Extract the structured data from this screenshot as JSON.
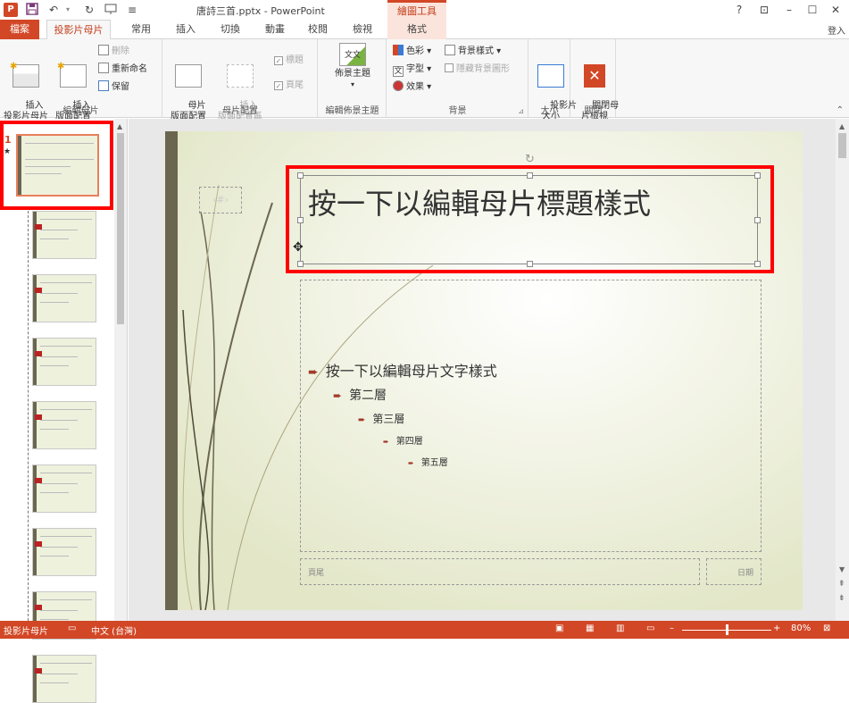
{
  "app": {
    "title": "唐詩三首.pptx - PowerPoint",
    "context_header": "繪圖工具",
    "qat": {
      "app_icon": "P",
      "save_icon": "save-icon",
      "undo_icon": "undo-icon",
      "redo_icon": "redo-icon",
      "presenter_icon": "presenter-icon",
      "customize": "≡"
    },
    "window": {
      "help": "?",
      "ribbon_opts": "⊡",
      "minimize": "–",
      "maximize": "☐",
      "close": "✕"
    },
    "signin": "登入"
  },
  "tabs": [
    {
      "label": "檔案"
    },
    {
      "label": "投影片母片"
    },
    {
      "label": "常用"
    },
    {
      "label": "插入"
    },
    {
      "label": "切換"
    },
    {
      "label": "動畫"
    },
    {
      "label": "校閱"
    },
    {
      "label": "檢視"
    },
    {
      "label": "格式"
    }
  ],
  "ribbon": {
    "groups": [
      {
        "label": "編輯母片"
      },
      {
        "label": "母片配置"
      },
      {
        "label": "編輯佈景主題"
      },
      {
        "label": "背景"
      },
      {
        "label": "大小"
      },
      {
        "label": "關閉"
      }
    ],
    "edit_master": {
      "insert_master": "插入\n投影片母片",
      "insert_layout": "插入\n版面配置",
      "delete": "刪除",
      "rename": "重新命名",
      "preserve": "保留"
    },
    "master_layout": {
      "master_layout": "母片\n版面配置",
      "insert_placeholder": "插入\n版面配置區",
      "title_chk": "標題",
      "footer_chk": "頁尾"
    },
    "theme": {
      "themes": "佈景主題"
    },
    "background": {
      "colors": "色彩",
      "fonts": "字型",
      "effects": "效果",
      "bg_styles": "背景樣式",
      "hide_bg": "隱藏背景圖形"
    },
    "size": {
      "slide_size": "投影片\n大小"
    },
    "close": {
      "close_master": "關閉母\n片檢視"
    }
  },
  "slide": {
    "number_placeholder": "‹#›",
    "title": "按一下以編輯母片標題樣式",
    "body": [
      {
        "text": "按一下以編輯母片文字樣式",
        "level": 1
      },
      {
        "text": "第二層",
        "level": 2
      },
      {
        "text": "第三層",
        "level": 3
      },
      {
        "text": "第四層",
        "level": 4
      },
      {
        "text": "第五層",
        "level": 5
      }
    ],
    "footer": "頁尾",
    "date": "日期"
  },
  "thumbnails": {
    "first_number": "1",
    "first_star": "★",
    "count": 8
  },
  "status": {
    "mode": "投影片母片",
    "lang": "中文 (台灣)",
    "zoom": "80%",
    "zoom_level": 0.5
  },
  "colors": {
    "accent": "#d24726",
    "highlight": "#ff0000",
    "slide_bg": "#eef0dc",
    "side_bar": "#6b6650",
    "bullet": "#a33a2a"
  }
}
